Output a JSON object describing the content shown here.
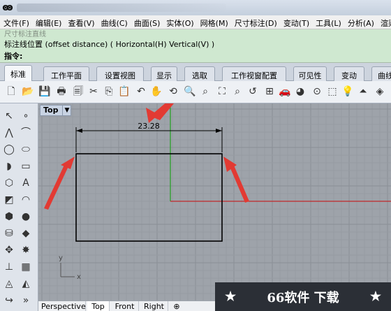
{
  "menu": [
    "文件(F)",
    "编辑(E)",
    "查看(V)",
    "曲线(C)",
    "曲面(S)",
    "实体(O)",
    "网格(M)",
    "尺寸标注(D)",
    "变动(T)",
    "工具(L)",
    "分析(A)",
    "渲染(R)"
  ],
  "command": {
    "partial_line": "尺寸标注直线",
    "prompt": "标注线位置 (offset distance) ( Horizontal(H)  Vertical(V) )",
    "input_label": "指令:"
  },
  "tabs": [
    "标准",
    "工作平面",
    "设置视图",
    "显示",
    "选取",
    "工作视窗配置",
    "可见性",
    "变动",
    "曲线"
  ],
  "active_tab": "标准",
  "viewport": {
    "name": "Top",
    "dimension_value": "23.28",
    "axis_y": "y",
    "axis_x": "x"
  },
  "view_tabs": [
    "Perspective",
    "Top",
    "Front",
    "Right"
  ],
  "active_view_tab": "Top",
  "add_view": "⊕",
  "watermark": {
    "star_left": "★",
    "text": "66软件 下载",
    "star_right": "★"
  },
  "colors": {
    "command_bg": "#cfe8d0",
    "viewport_bg": "#9ea3aa",
    "annotation_arrow": "#e23a33",
    "world_axis_x": "#c0282a",
    "world_axis_y": "#2aa02a"
  }
}
